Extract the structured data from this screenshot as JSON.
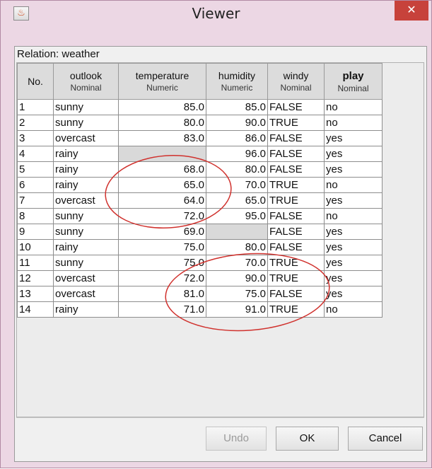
{
  "window": {
    "title": "Viewer",
    "close_symbol": "✕",
    "app_icon": "java-icon"
  },
  "relation_label": "Relation: weather",
  "columns": [
    {
      "name": "No.",
      "type": ""
    },
    {
      "name": "outlook",
      "type": "Nominal"
    },
    {
      "name": "temperature",
      "type": "Numeric"
    },
    {
      "name": "humidity",
      "type": "Numeric"
    },
    {
      "name": "windy",
      "type": "Nominal"
    },
    {
      "name": "play",
      "type": "Nominal"
    }
  ],
  "rows": [
    {
      "no": "1",
      "outlook": "sunny",
      "temperature": "85.0",
      "humidity": "85.0",
      "windy": "FALSE",
      "play": "no"
    },
    {
      "no": "2",
      "outlook": "sunny",
      "temperature": "80.0",
      "humidity": "90.0",
      "windy": "TRUE",
      "play": "no"
    },
    {
      "no": "3",
      "outlook": "overcast",
      "temperature": "83.0",
      "humidity": "86.0",
      "windy": "FALSE",
      "play": "yes"
    },
    {
      "no": "4",
      "outlook": "rainy",
      "temperature": "",
      "humidity": "96.0",
      "windy": "FALSE",
      "play": "yes"
    },
    {
      "no": "5",
      "outlook": "rainy",
      "temperature": "68.0",
      "humidity": "80.0",
      "windy": "FALSE",
      "play": "yes"
    },
    {
      "no": "6",
      "outlook": "rainy",
      "temperature": "65.0",
      "humidity": "70.0",
      "windy": "TRUE",
      "play": "no"
    },
    {
      "no": "7",
      "outlook": "overcast",
      "temperature": "64.0",
      "humidity": "65.0",
      "windy": "TRUE",
      "play": "yes"
    },
    {
      "no": "8",
      "outlook": "sunny",
      "temperature": "72.0",
      "humidity": "95.0",
      "windy": "FALSE",
      "play": "no"
    },
    {
      "no": "9",
      "outlook": "sunny",
      "temperature": "69.0",
      "humidity": "",
      "windy": "FALSE",
      "play": "yes"
    },
    {
      "no": "10",
      "outlook": "rainy",
      "temperature": "75.0",
      "humidity": "80.0",
      "windy": "FALSE",
      "play": "yes"
    },
    {
      "no": "11",
      "outlook": "sunny",
      "temperature": "75.0",
      "humidity": "70.0",
      "windy": "TRUE",
      "play": "yes"
    },
    {
      "no": "12",
      "outlook": "overcast",
      "temperature": "72.0",
      "humidity": "90.0",
      "windy": "TRUE",
      "play": "yes"
    },
    {
      "no": "13",
      "outlook": "overcast",
      "temperature": "81.0",
      "humidity": "75.0",
      "windy": "FALSE",
      "play": "yes"
    },
    {
      "no": "14",
      "outlook": "rainy",
      "temperature": "71.0",
      "humidity": "91.0",
      "windy": "TRUE",
      "play": "no"
    }
  ],
  "buttons": {
    "undo": "Undo",
    "ok": "OK",
    "cancel": "Cancel"
  },
  "colors": {
    "titlebar": "#ecd7e4",
    "close_button": "#c7423b",
    "missing_cell": "#d9d9d9",
    "annotation_circle": "#d0312d"
  }
}
